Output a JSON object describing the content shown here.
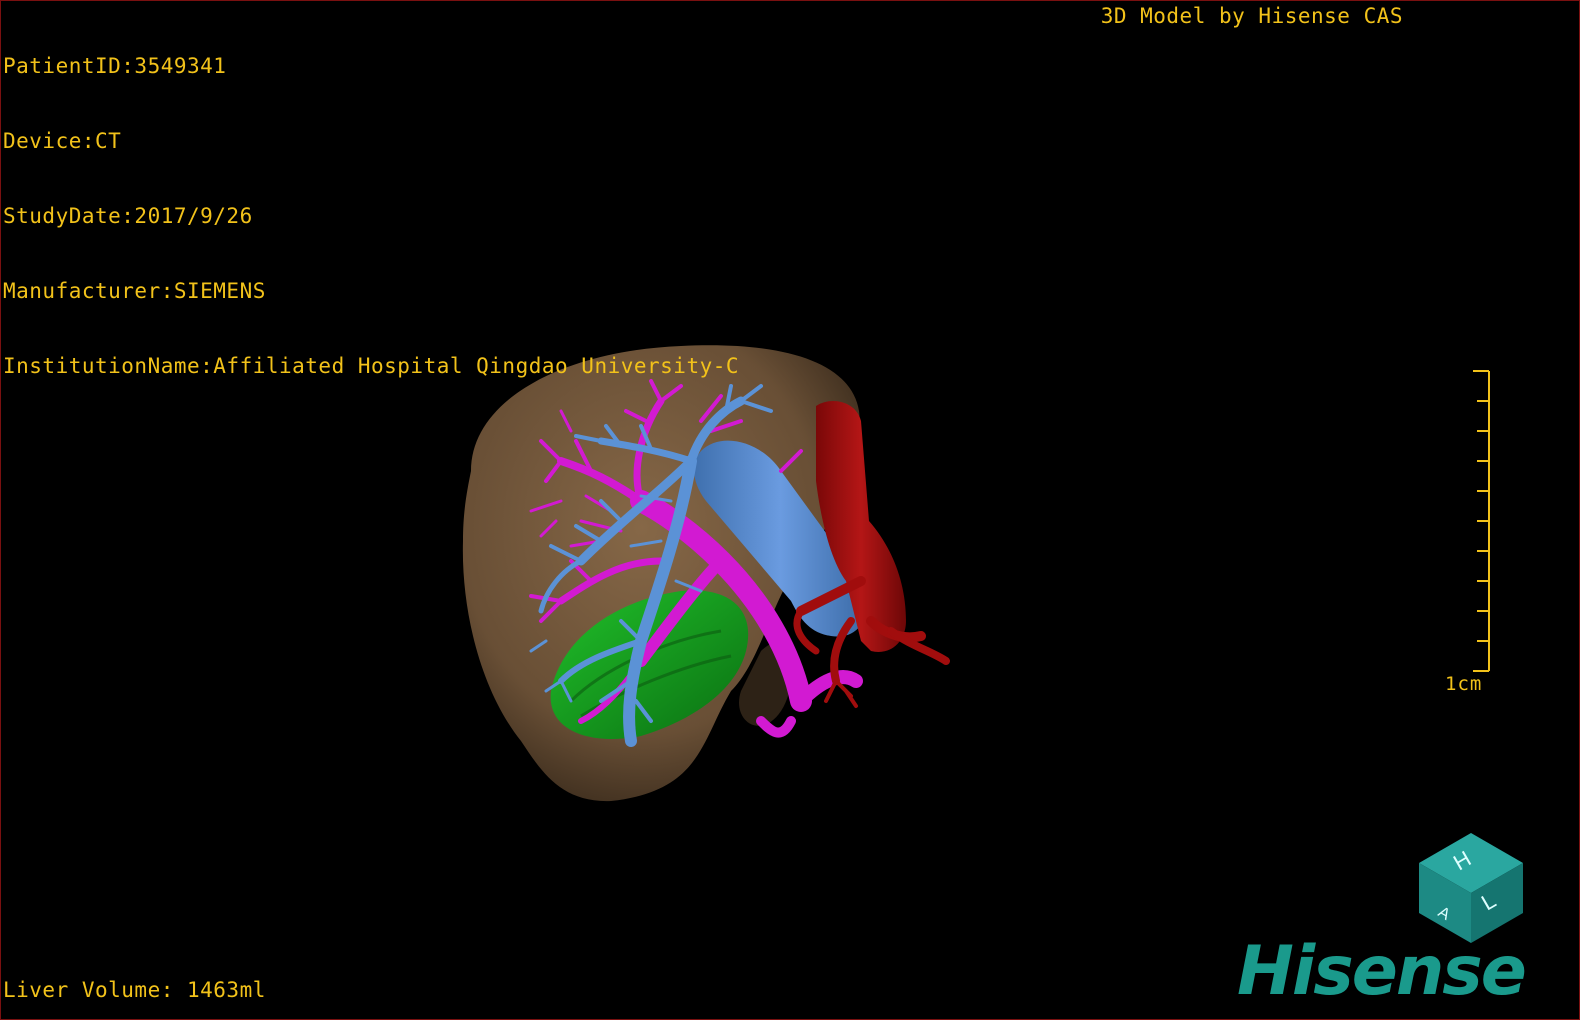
{
  "dicom_info": {
    "patient_id": "PatientID:3549341",
    "device": "Device:CT",
    "study_date": "StudyDate:2017/9/26",
    "manufacturer": "Manufacturer:SIEMENS",
    "institution": "InstitutionName:Affiliated Hospital Qingdao University-C"
  },
  "app_credit": "3D Model by Hisense CAS",
  "liver_volume": "Liver Volume: 1463ml",
  "scale": {
    "label": "1cm"
  },
  "logo": "Hisense",
  "orientation_cube": {
    "faces": [
      "H",
      "L",
      "A"
    ]
  },
  "structures": [
    {
      "name": "liver",
      "color": "#8a6a48"
    },
    {
      "name": "portal-vein",
      "color": "#d21ad2"
    },
    {
      "name": "hepatic-vein",
      "color": "#4d86c8"
    },
    {
      "name": "inferior-vena-cava",
      "color": "#a10d0d"
    },
    {
      "name": "tumor",
      "color": "#14a01e"
    }
  ],
  "colors": {
    "text": "#f2c21a",
    "background": "#000000",
    "brand": "#1a9a8c"
  }
}
